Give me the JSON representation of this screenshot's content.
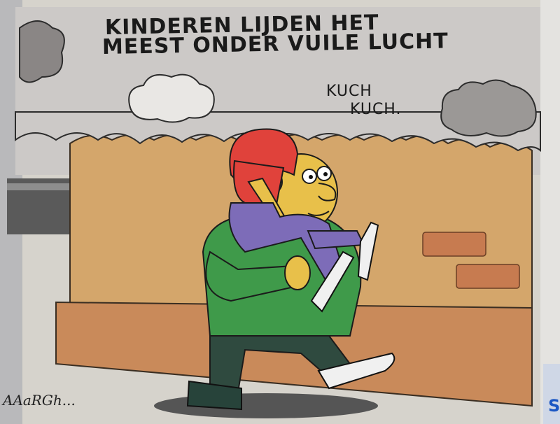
{
  "comic": {
    "caption_line1": "KINDEREN LIJDEN HET",
    "caption_line2": "MEEST ONDER VUILE LUCHT",
    "cough_line1": "KUCH",
    "cough_line2": "KUCH.",
    "signature": "AAaRGh...",
    "edge_letter": "S"
  },
  "colors": {
    "sky": "#ccc9c7",
    "wall": "#d4a66b",
    "wall_base": "#c98a5a",
    "sweater": "#3f9a4a",
    "child_shirt": "#e0423b",
    "child_pants": "#7d6cb8",
    "skin": "#e8c04a",
    "trousers": "#2f4a3f"
  }
}
